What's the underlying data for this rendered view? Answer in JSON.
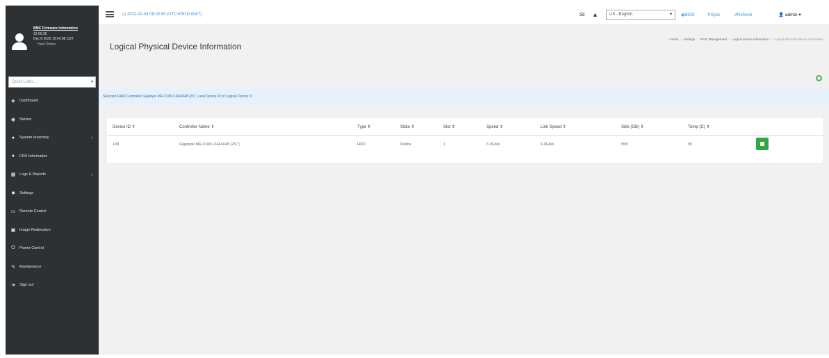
{
  "profile": {
    "lines": [
      "BMC Firmware Information",
      "12.60.35",
      "Dec 8 2022 15:42:08 CST"
    ],
    "status": "Host Online"
  },
  "quicklinks": {
    "placeholder": "Quick Links..."
  },
  "nav": [
    {
      "label": "Dashboard",
      "icon": "dashboard-icon",
      "glyph": "◈",
      "arrow": false
    },
    {
      "label": "Sensor",
      "icon": "sensor-icon",
      "glyph": "◉",
      "arrow": false
    },
    {
      "label": "System Inventory",
      "icon": "inventory-icon",
      "glyph": "●",
      "arrow": true
    },
    {
      "label": "FRU Information",
      "icon": "fru-icon",
      "glyph": "●",
      "arrow": false
    },
    {
      "label": "Logs & Reports",
      "icon": "logs-icon",
      "glyph": "▦",
      "arrow": true
    },
    {
      "label": "Settings",
      "icon": "settings-icon",
      "glyph": "✹",
      "arrow": false
    },
    {
      "label": "Remote Control",
      "icon": "remote-control-icon",
      "glyph": "▭",
      "arrow": false
    },
    {
      "label": "Image Redirection",
      "icon": "image-redirection-icon",
      "glyph": "▣",
      "arrow": false
    },
    {
      "label": "Power Control",
      "icon": "power-icon",
      "glyph": "⏻",
      "arrow": false
    },
    {
      "label": "Maintenance",
      "icon": "maintenance-icon",
      "glyph": "✎",
      "arrow": false
    },
    {
      "label": "Sign out",
      "icon": "sign-out-icon",
      "glyph": "➜",
      "arrow": false
    }
  ],
  "topbar": {
    "datetime": "2022-02-04 08:02:50 (UTC+05:00 GMT)",
    "language": "US - English",
    "bios": "BIOS",
    "sync": "Sync",
    "refresh": "Refresh",
    "user": "admin"
  },
  "page": {
    "title": "Logical Physical Device Information",
    "breadcrumb": [
      "Home",
      "Settings",
      "RAID Management",
      "Logical Device Information"
    ],
    "breadcrumb_current": "Logical Physical Device Information",
    "banner": "Selected RAID Controller:Gigabyte MR-3108-CRA4048 (257 ) and Device ID of Logical Device: 0"
  },
  "table": {
    "columns": [
      "Device ID ⇕",
      "Controller Name ⇕",
      "Type ⇕",
      "State ⇕",
      "Slot ⇕",
      "Speed ⇕",
      "Link Speed ⇕",
      "Size (GB) ⇕",
      "Temp (C) ⇕",
      ""
    ],
    "rows": [
      {
        "device_id": "108",
        "controller": "Gigabyte MR-3108-CRA4048 (257 )",
        "type": "HDD",
        "state": "Online",
        "slot": "1",
        "speed": "6.0Gb/s",
        "link_speed": "6.0Gb/s",
        "size": "558",
        "temp": "55"
      }
    ]
  },
  "colors": {
    "sidebar": "#2d3134",
    "accent": "#3a8fd6",
    "view_button": "#2fa843"
  }
}
